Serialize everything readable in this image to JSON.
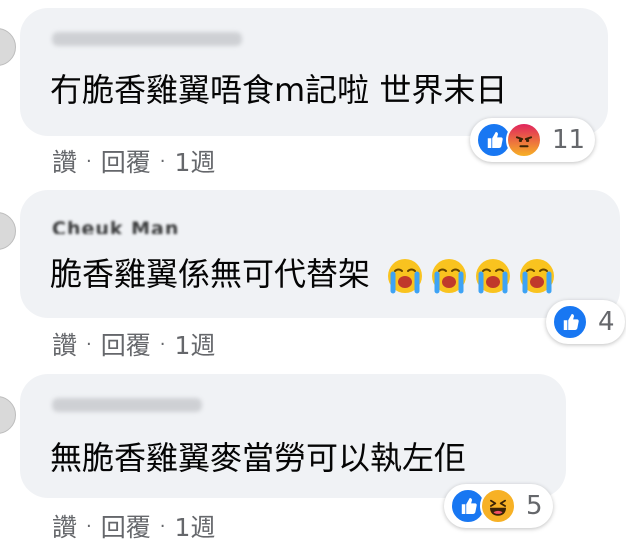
{
  "comments": [
    {
      "text": "冇脆香雞翼唔食m記啦 世界末日",
      "actions": {
        "like": "讚",
        "reply": "回覆",
        "time": "1週"
      },
      "reactions": [
        "like",
        "angry"
      ],
      "reaction_count": "11"
    },
    {
      "author": "Cheuk Man",
      "text": "脆香雞翼係無可代替架",
      "emojis": [
        "loudly-crying-face",
        "loudly-crying-face",
        "loudly-crying-face",
        "loudly-crying-face"
      ],
      "actions": {
        "like": "讚",
        "reply": "回覆",
        "time": "1週"
      },
      "reactions": [
        "like"
      ],
      "reaction_count": "4"
    },
    {
      "text": "無脆香雞翼麥當勞可以執左佢",
      "actions": {
        "like": "讚",
        "reply": "回覆",
        "time": "1週"
      },
      "reactions": [
        "like",
        "haha"
      ],
      "reaction_count": "5"
    }
  ],
  "colors": {
    "bubble": "#f0f2f5",
    "like_blue": "#1877f2",
    "angry": "#e9710f",
    "haha": "#f7b125",
    "meta_text": "#65676b"
  }
}
